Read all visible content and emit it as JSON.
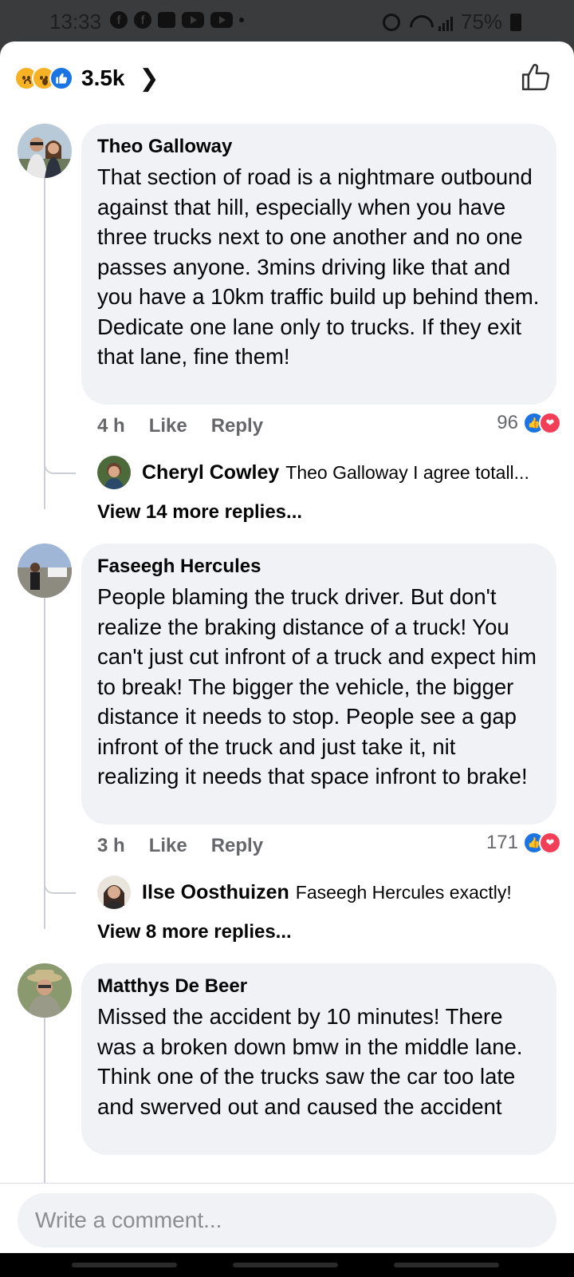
{
  "status_bar": {
    "time": "13:33",
    "battery": "75%"
  },
  "reactions": {
    "count": "3.5k",
    "icons": [
      "sad-reaction-icon",
      "wow-reaction-icon",
      "like-reaction-icon"
    ]
  },
  "comments": [
    {
      "author": "Theo Galloway",
      "text": "That section of road is a nightmare outbound against that hill, especially when you have three trucks next to one another and no one passes anyone. 3mins driving like that and you have a 10km traffic build up behind them. Dedicate one lane only to trucks. If they exit that lane, fine them!",
      "time": "4 h",
      "like_label": "Like",
      "reply_label": "Reply",
      "reaction_count": "96",
      "reply_preview": {
        "author": "Cheryl Cowley",
        "text": "Theo Galloway  I agree totall..."
      },
      "more_replies": "View 14 more replies..."
    },
    {
      "author": "Faseegh Hercules",
      "text": "People blaming the truck driver. But don't realize the braking distance of a truck! You can't just cut infront of a truck and expect him to break! The bigger the vehicle, the bigger distance it needs to stop. People see a gap infront of the truck and just take it, nit realizing it needs that space infront to brake!",
      "time": "3 h",
      "like_label": "Like",
      "reply_label": "Reply",
      "reaction_count": "171",
      "reply_preview": {
        "author": "Ilse Oosthuizen",
        "text": "Faseegh Hercules exactly!"
      },
      "more_replies": "View 8 more replies..."
    },
    {
      "author": "Matthys De Beer",
      "text": "Missed the accident by 10 minutes! There was a broken down  bmw in the middle lane. Think one of the trucks saw the car too late and swerved out and caused the accident"
    }
  ],
  "composer": {
    "placeholder": "Write a comment..."
  },
  "colors": {
    "accent": "#1b74e4",
    "love": "#f33e58",
    "bubble": "#f0f2f5",
    "muted": "#65676b"
  }
}
